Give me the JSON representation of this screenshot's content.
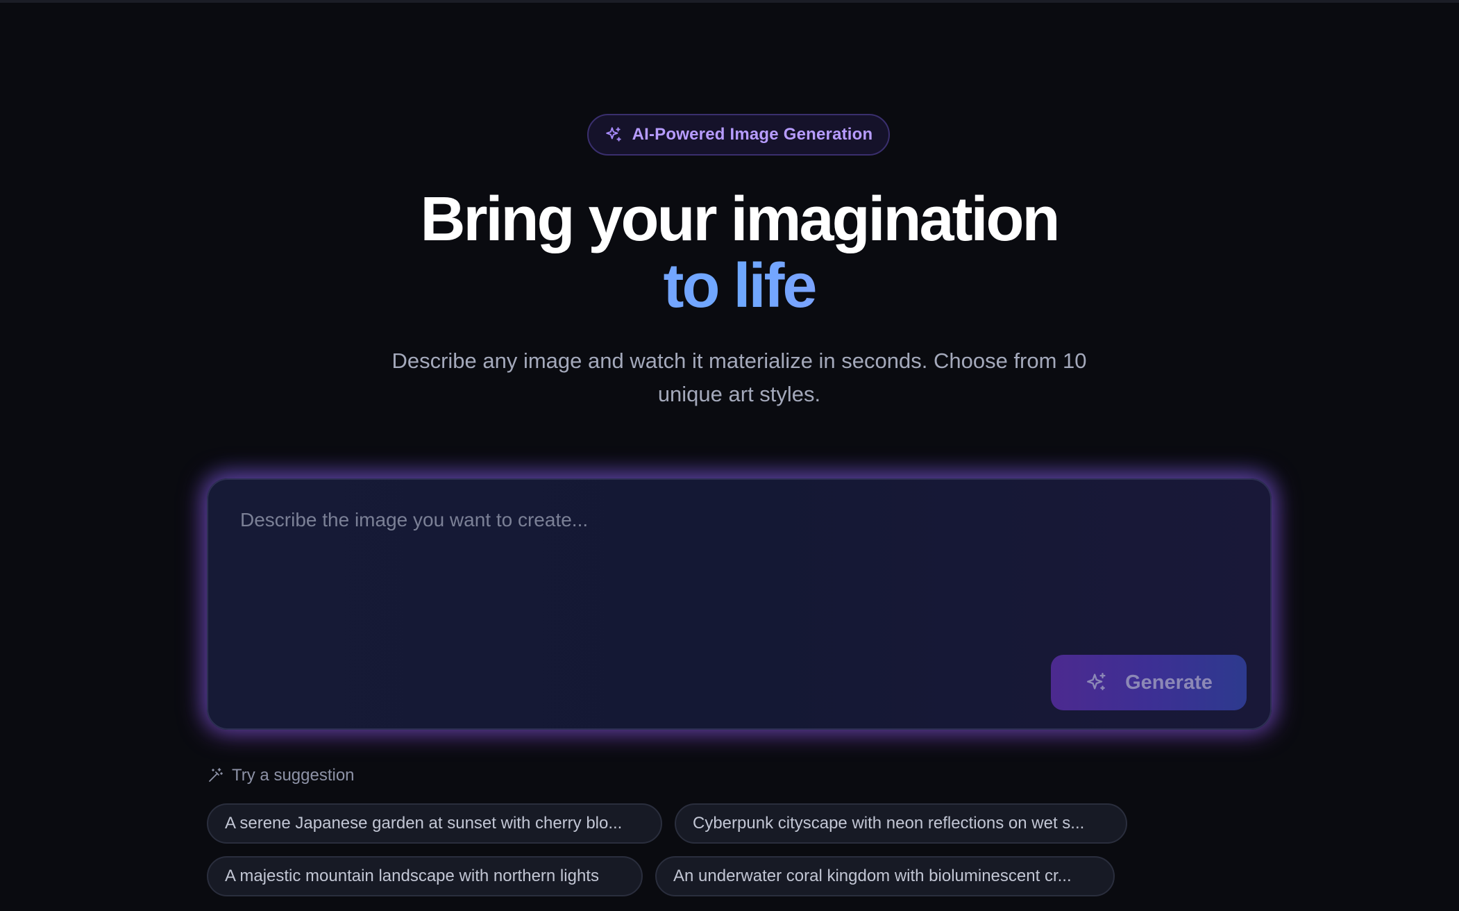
{
  "badge": {
    "icon": "sparkles-icon",
    "label": "AI-Powered Image Generation"
  },
  "hero": {
    "headline_line1": "Bring your imagination",
    "headline_line2": "to life",
    "subtitle": "Describe any image and watch it materialize in seconds. Choose from 10 unique art styles."
  },
  "prompt": {
    "value": "",
    "placeholder": "Describe the image you want to create...",
    "generate_label": "Generate"
  },
  "suggestions": {
    "title": "Try a suggestion",
    "items": [
      "A serene Japanese garden at sunset with cherry blo...",
      "Cyberpunk cityscape with neon reflections on wet s...",
      "A majestic mountain landscape with northern lights",
      "An underwater coral kingdom with bioluminescent cr..."
    ]
  },
  "colors": {
    "background": "#0a0b10",
    "accent_purple": "#a78bfa",
    "accent_blue": "#6ea8ff",
    "accent_pink": "#e879f9"
  }
}
